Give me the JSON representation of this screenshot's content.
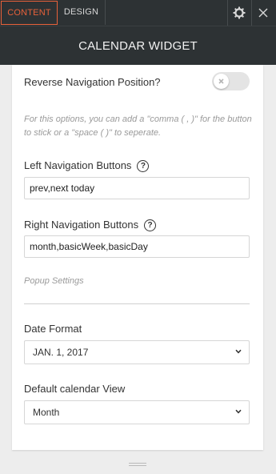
{
  "tabs": [
    {
      "label": "CONTENT",
      "active": true
    },
    {
      "label": "DESIGN",
      "active": false
    }
  ],
  "icons": {
    "settings": "gear-icon",
    "close": "close-icon"
  },
  "header": {
    "title": "CALENDAR WIDGET"
  },
  "settings": {
    "reverse_nav": {
      "label": "Reverse Navigation Position?",
      "enabled": false
    },
    "hint": "For this options, you can add a \"comma ( , )\" for the button to stick or a \"space ( )\" to seperate.",
    "left_nav": {
      "label": "Left Navigation Buttons",
      "help": "?",
      "value": "prev,next today"
    },
    "right_nav": {
      "label": "Right Navigation Buttons",
      "help": "?",
      "value": "month,basicWeek,basicDay"
    },
    "popup_section": "Popup Settings",
    "date_format": {
      "label": "Date Format",
      "value": "JAN. 1, 2017"
    },
    "default_view": {
      "label": "Default calendar View",
      "value": "Month"
    }
  },
  "colors": {
    "accent": "#e8613a",
    "dark_bar": "#2d3234"
  }
}
